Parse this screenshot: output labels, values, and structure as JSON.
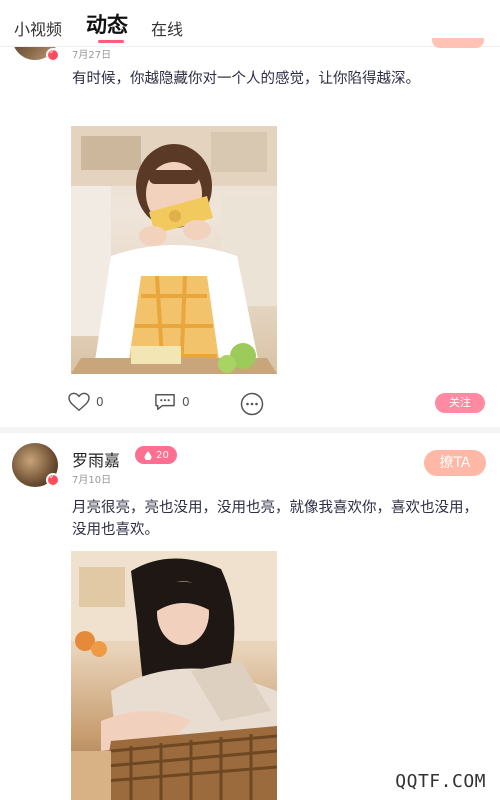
{
  "tabs": [
    {
      "label": "小视频"
    },
    {
      "label": "动态"
    },
    {
      "label": "在线"
    }
  ],
  "post1": {
    "date": "7月27日",
    "content": "有时候，你越隐藏你对一个人的感觉，让你陷得越深。",
    "likes": "0",
    "comments": "0",
    "follow_label": "关注"
  },
  "post2": {
    "username": "罗雨嘉",
    "level": "20",
    "chat_label": "撩TA",
    "date": "7月10日",
    "content": "月亮很亮，亮也没用，没用也亮，就像我喜欢你，喜欢也没用，没用也喜欢。"
  },
  "watermark": "QQTF.COM",
  "colors": {
    "accent": "#ff5c7c",
    "follow": "#ff8aa1",
    "chat": "#ffb7a6"
  }
}
